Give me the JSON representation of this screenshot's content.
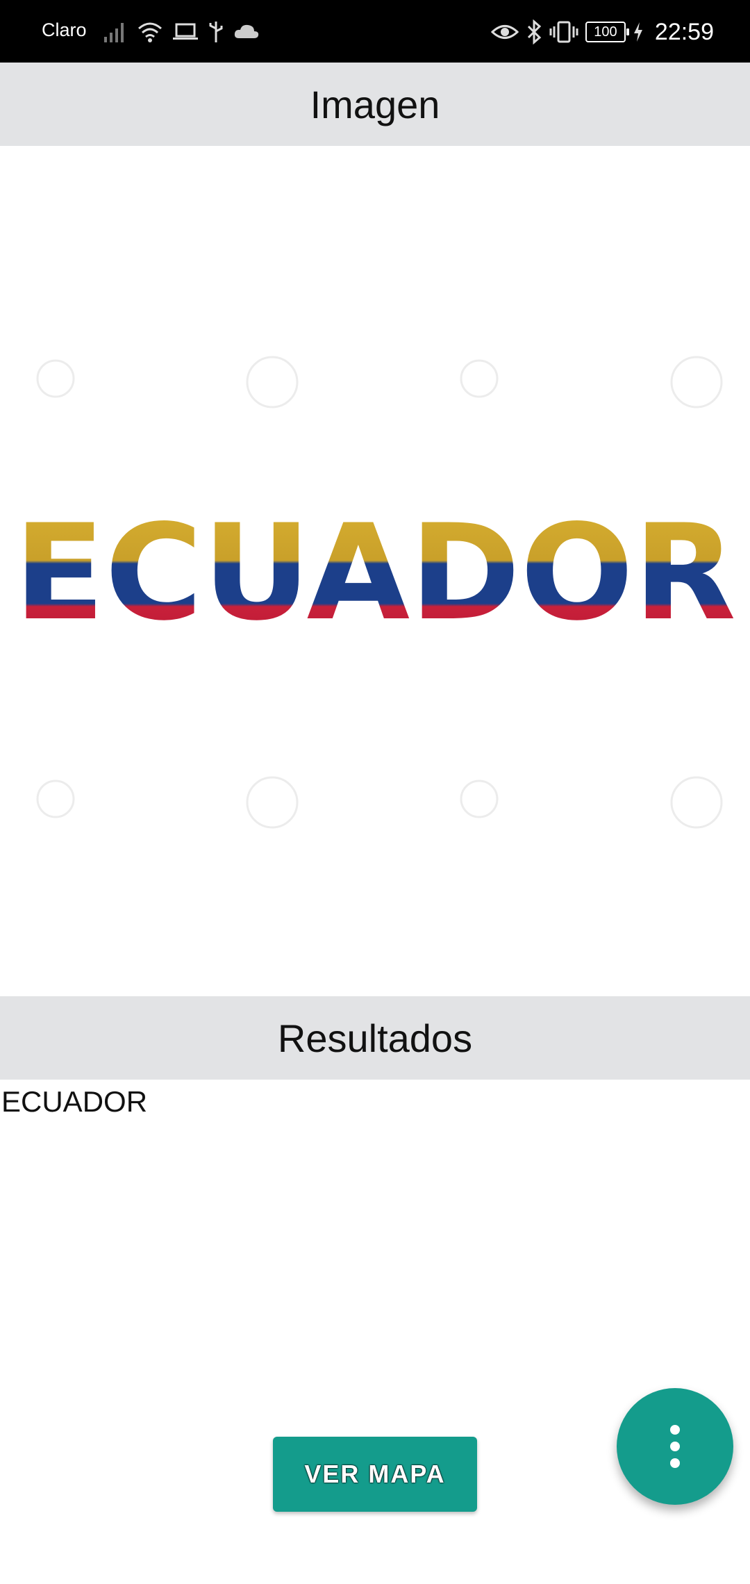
{
  "status_bar": {
    "carrier": "Claro",
    "battery": "100",
    "time": "22:59",
    "left_icons": [
      "signal-icon",
      "wifi-icon",
      "laptop-icon",
      "usb-icon",
      "cloud-icon"
    ],
    "right_icons": [
      "eye-icon",
      "bluetooth-icon",
      "vibrate-icon",
      "battery-icon",
      "charging-icon"
    ]
  },
  "image_section": {
    "title": "Imagen",
    "image": {
      "word": "ECUADOR",
      "flag_colors": [
        "#d9b131",
        "#1c3f8a",
        "#c8203a"
      ]
    }
  },
  "results_section": {
    "title": "Resultados",
    "result": "ECUADOR"
  },
  "actions": {
    "map_button_label": "VER MAPA",
    "fab_icon": "more-vertical-icon",
    "accent_color": "#149c8c"
  }
}
